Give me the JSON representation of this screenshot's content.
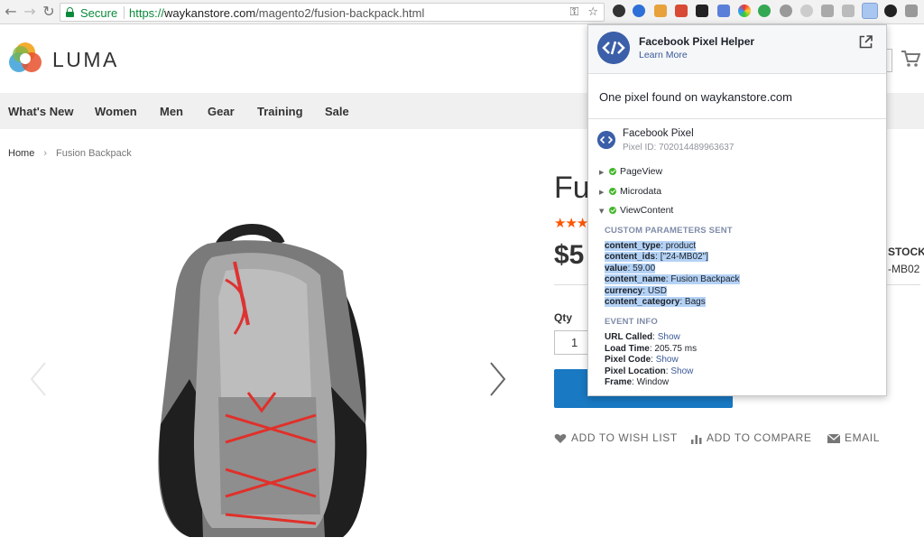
{
  "browser": {
    "secure_label": "Secure",
    "url_scheme": "https://",
    "url_host": "waykanstore.com",
    "url_path": "/magento2/fusion-backpack.html"
  },
  "site": {
    "logo_text": "LUMA",
    "nav": [
      "What's New",
      "Women",
      "Men",
      "Gear",
      "Training",
      "Sale"
    ],
    "breadcrumb": {
      "home": "Home",
      "current": "Fusion Backpack"
    }
  },
  "product": {
    "title": "Fu",
    "stars": "★★★",
    "price": "$5",
    "stock": "STOCK",
    "sku": "-MB02",
    "qty_label": "Qty",
    "qty_value": "1",
    "wishlist": "ADD TO WISH LIST",
    "compare": "ADD TO COMPARE",
    "email": "EMAIL"
  },
  "pixel_helper": {
    "title": "Facebook Pixel Helper",
    "learn_more": "Learn More",
    "found": "One pixel found on waykanstore.com",
    "pixel_name": "Facebook Pixel",
    "pixel_id": "Pixel ID: 702014489963637",
    "events": [
      "PageView",
      "Microdata",
      "ViewContent"
    ],
    "custom_header": "CUSTOM PARAMETERS SENT",
    "params": [
      {
        "key": "content_type",
        "value": "product"
      },
      {
        "key": "content_ids",
        "value": "[\"24-MB02\"]"
      },
      {
        "key": "value",
        "value": "59.00"
      },
      {
        "key": "content_name",
        "value": "Fusion Backpack"
      },
      {
        "key": "currency",
        "value": "USD"
      },
      {
        "key": "content_category",
        "value": "Bags"
      }
    ],
    "event_header": "EVENT INFO",
    "event_info": [
      {
        "key": "URL Called",
        "value": "Show"
      },
      {
        "key": "Load Time",
        "value": "205.75 ms"
      },
      {
        "key": "Pixel Code",
        "value": "Show"
      },
      {
        "key": "Pixel Location",
        "value": "Show"
      },
      {
        "key": "Frame",
        "value": "Window"
      }
    ]
  },
  "colors": {
    "secure_green": "#0a8a3b",
    "luma_blue": "#1979c3",
    "star_orange": "#ff5501",
    "fb_blue": "#3b5fa8",
    "highlight": "#b4d2f5"
  }
}
